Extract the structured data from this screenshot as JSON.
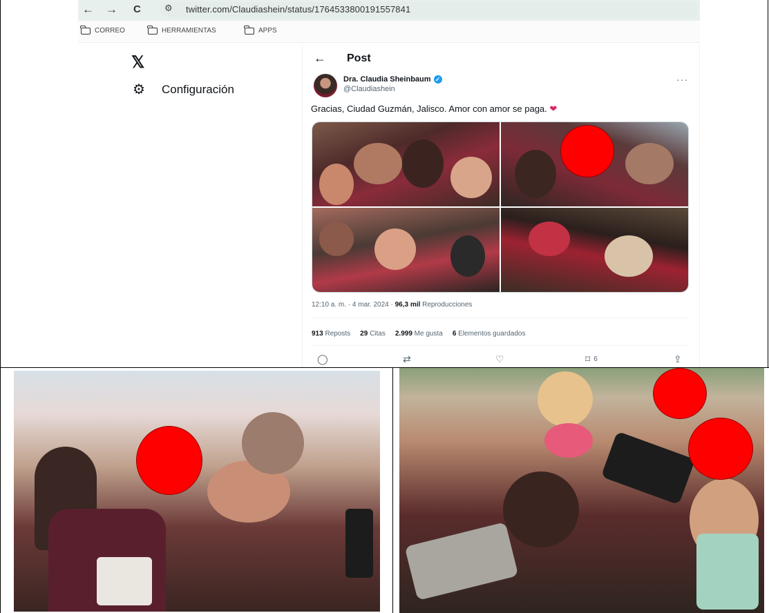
{
  "browser": {
    "back_glyph": "←",
    "forward_glyph": "→",
    "reload_glyph": "C",
    "url": "twitter.com/Claudiashein/status/1764533800191557841",
    "bookmarks": [
      "CORREO",
      "HERRAMIENTAS",
      "APPS"
    ]
  },
  "sidebar": {
    "logo": "𝕏",
    "settings_label": "Configuración"
  },
  "post": {
    "header_title": "Post",
    "author_name": "Dra. Claudia Sheinbaum",
    "author_handle": "@Claudiashein",
    "text": "Gracias, Ciudad Guzmán, Jalisco. Amor con amor se paga.",
    "time": "12:10 a. m.",
    "date": "4 mar. 2024",
    "views_value": "96,3 mil",
    "views_label": "Reproducciones",
    "reposts_value": "913",
    "reposts_label": "Reposts",
    "quotes_value": "29",
    "quotes_label": "Citas",
    "likes_value": "2.999",
    "likes_label": "Me gusta",
    "bookmarks_value": "6",
    "bookmarks_label": "Elementos guardados",
    "action_bookmark_count": "6"
  },
  "colors": {
    "accent": "#1d9bf0",
    "heart": "#e0245e",
    "privacy_dot": "#ff0000"
  }
}
